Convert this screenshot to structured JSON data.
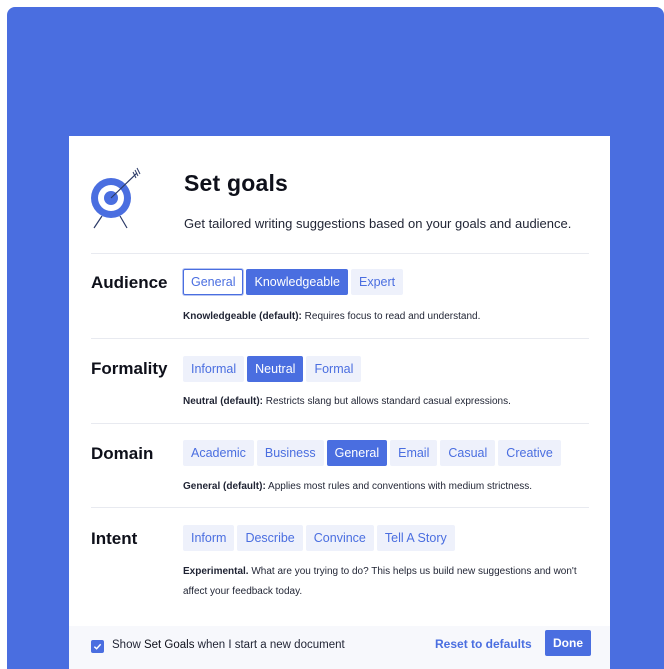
{
  "dialog": {
    "title": "Set goals",
    "subtitle": "Get tailored writing suggestions based on your goals and audience."
  },
  "sections": {
    "audience": {
      "label": "Audience",
      "options": [
        "General",
        "Knowledgeable",
        "Expert"
      ],
      "selected": "Knowledgeable",
      "focused": "General",
      "desc_bold": "Knowledgeable (default):",
      "desc_text": " Requires focus to read and understand."
    },
    "formality": {
      "label": "Formality",
      "options": [
        "Informal",
        "Neutral",
        "Formal"
      ],
      "selected": "Neutral",
      "desc_bold": "Neutral (default):",
      "desc_text": " Restricts slang but allows standard casual expressions."
    },
    "domain": {
      "label": "Domain",
      "options": [
        "Academic",
        "Business",
        "General",
        "Email",
        "Casual",
        "Creative"
      ],
      "selected": "General",
      "desc_bold": "General (default):",
      "desc_text": " Applies most rules and conventions with medium strictness."
    },
    "intent": {
      "label": "Intent",
      "options": [
        "Inform",
        "Describe",
        "Convince",
        "Tell A Story"
      ],
      "selected": "",
      "desc_bold": "Experimental.",
      "desc_text": " What are you trying to do? This helps us build new suggestions and won't affect your feedback today."
    }
  },
  "footer": {
    "checkbox_checked": true,
    "text_before": "Show ",
    "text_bold": "Set Goals",
    "text_after": " when I start a new document",
    "reset_label": "Reset to defaults",
    "done_label": "Done"
  },
  "colors": {
    "accent": "#4a6ee0",
    "chip_bg": "#eef1fb",
    "footer_bg": "#f7f8fc"
  },
  "icons": {
    "hero": "target-arrow-icon",
    "checkbox": "checkmark-icon"
  }
}
